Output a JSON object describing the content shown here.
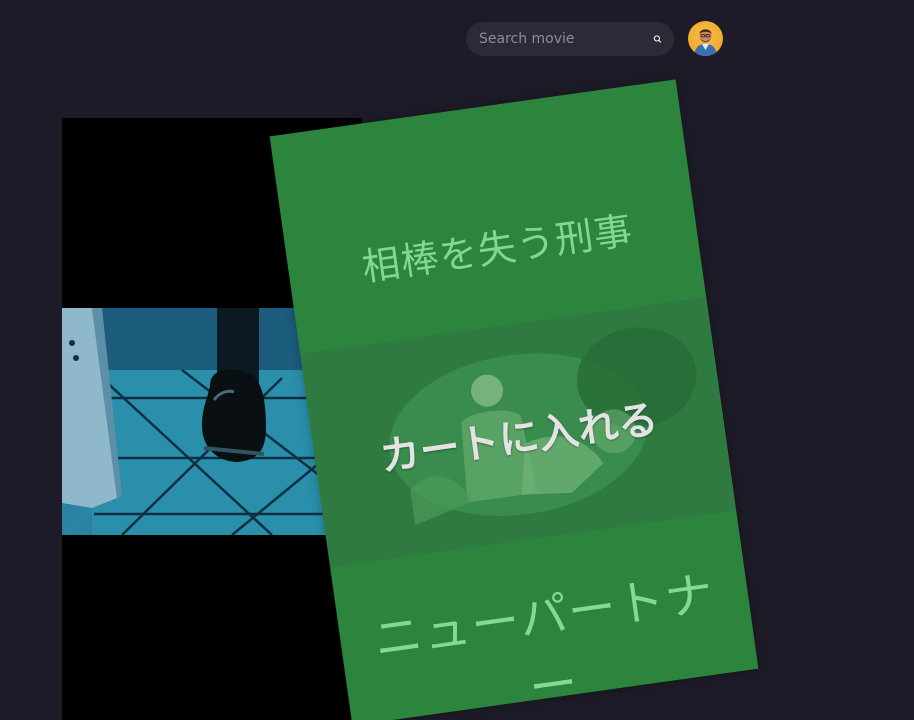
{
  "header": {
    "search": {
      "placeholder": "Search movie",
      "value": ""
    },
    "icons": {
      "search": "search-icon",
      "avatar": "user-avatar"
    }
  },
  "video": {
    "scene": "dark tiled room with a man's dress shoe"
  },
  "promo": {
    "title": "相棒を失う刑事",
    "cta_label": "カートに入れる",
    "subtitle": "ニューパートナー",
    "colors": {
      "card": "#2d843d",
      "text": "#7fd98e",
      "cta": "#e3e3e3"
    }
  },
  "colors": {
    "background": "#1c1b27",
    "search_bg": "#2b2a37"
  }
}
